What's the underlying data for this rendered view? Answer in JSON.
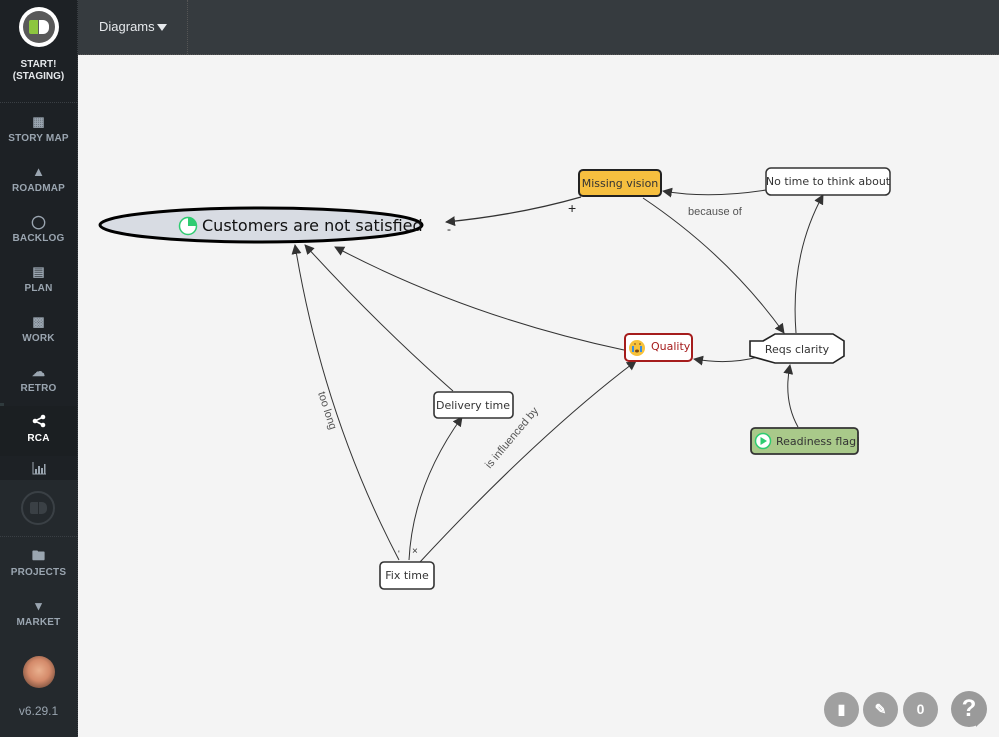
{
  "app": {
    "brand_line1": "START!",
    "brand_line2": "(STAGING)",
    "version": "v6.29.1"
  },
  "sidebar": {
    "items": [
      {
        "label": "STORY MAP",
        "icon": "grid-icon"
      },
      {
        "label": "ROADMAP",
        "icon": "road-icon"
      },
      {
        "label": "BACKLOG",
        "icon": "lightbulb-icon"
      },
      {
        "label": "PLAN",
        "icon": "list-icon"
      },
      {
        "label": "WORK",
        "icon": "briefcase-icon"
      },
      {
        "label": "RETRO",
        "icon": "chat-bubbles-icon"
      },
      {
        "label": "RCA",
        "icon": "share-icon",
        "active": true
      },
      {
        "label": "",
        "icon": "bar-chart-icon"
      }
    ],
    "lower_items": [
      {
        "label": "PROJECTS",
        "icon": "folder-icon"
      },
      {
        "label": "MARKET",
        "icon": "shopping-bag-icon"
      }
    ]
  },
  "topbar": {
    "diagrams_label": "Diagrams"
  },
  "diagram": {
    "nodes": {
      "customers": {
        "label": "Customers are not satisfied",
        "shape": "ellipse",
        "icon": "pie-progress-icon"
      },
      "missing_vision": {
        "label": "Missing vision",
        "fill": "#f6bf3f"
      },
      "no_time": {
        "label": "No time to think about"
      },
      "quality": {
        "label": "Quality",
        "icon": "crying-face-emoji",
        "border": "#a51c1c"
      },
      "reqs": {
        "label": "Reqs clarity",
        "shape": "octagon"
      },
      "readiness": {
        "label": "Readiness flag!",
        "fill": "#a9c98a",
        "icon": "play-icon"
      },
      "delivery": {
        "label": "Delivery time"
      },
      "fix": {
        "label": "Fix time"
      }
    },
    "edge_labels": {
      "because_of": "because of",
      "too_long": "too long",
      "is_influenced_by": "is influenced by",
      "plus_marker": "+",
      "minus_marker": "-",
      "x_marker": "×",
      "tick_marker": "'"
    }
  },
  "fabs": {
    "book": "book-icon",
    "edit": "pencil-icon",
    "count": "0",
    "help": "?"
  }
}
